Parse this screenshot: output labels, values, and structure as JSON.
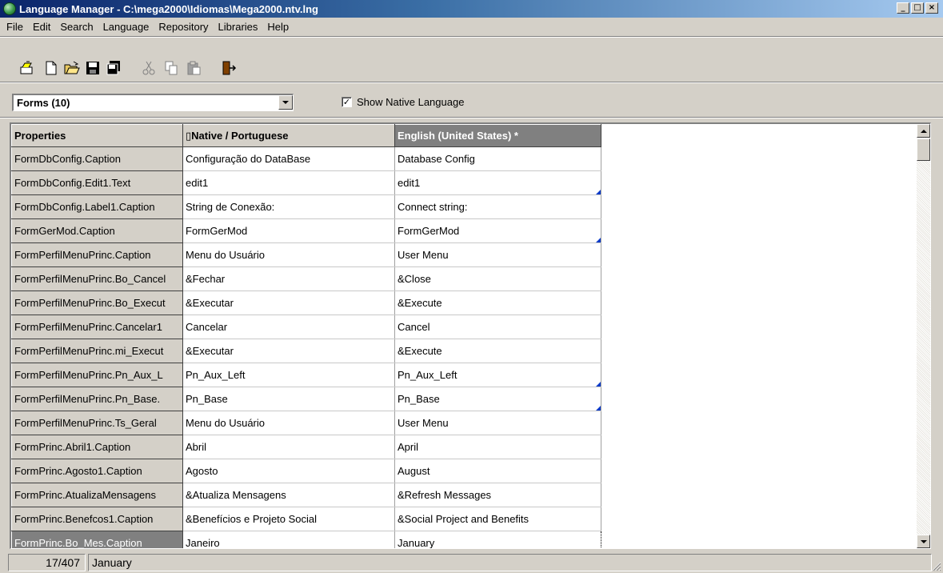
{
  "window": {
    "title": "Language Manager - C:\\mega2000\\Idiomas\\Mega2000.ntv.lng",
    "caption_buttons": [
      "minimize",
      "maximize",
      "close"
    ]
  },
  "menu": [
    "File",
    "Edit",
    "Search",
    "Language",
    "Repository",
    "Libraries",
    "Help"
  ],
  "toolbar": {
    "icons": [
      "repository-open-icon",
      "new-file-icon",
      "open-folder-icon",
      "save-icon",
      "save-all-icon",
      "cut-icon",
      "copy-icon",
      "paste-icon",
      "exit-icon"
    ]
  },
  "filter": {
    "combo_value": "Forms (10)",
    "show_native_label": "Show Native Language",
    "show_native_checked": true,
    "check_glyph": "✓"
  },
  "grid": {
    "headers": {
      "properties": "Properties",
      "native": "Native / Portuguese",
      "english": "English (United States) *"
    },
    "rows": [
      {
        "prop": "FormDbConfig.Caption",
        "native": "Configuração do DataBase",
        "en": "Database Config",
        "marked": false
      },
      {
        "prop": "FormDbConfig.Edit1.Text",
        "native": "edit1",
        "en": "edit1",
        "marked": true
      },
      {
        "prop": "FormDbConfig.Label1.Caption",
        "native": "String de Conexão:",
        "en": "Connect string:",
        "marked": false
      },
      {
        "prop": "FormGerMod.Caption",
        "native": "FormGerMod",
        "en": "FormGerMod",
        "marked": true
      },
      {
        "prop": "FormPerfilMenuPrinc.Caption",
        "native": "Menu do Usuário",
        "en": "User Menu",
        "marked": false
      },
      {
        "prop": "FormPerfilMenuPrinc.Bo_Cancel",
        "native": "&Fechar",
        "en": "&Close",
        "marked": false
      },
      {
        "prop": "FormPerfilMenuPrinc.Bo_Execut",
        "native": "&Executar",
        "en": "&Execute",
        "marked": false
      },
      {
        "prop": "FormPerfilMenuPrinc.Cancelar1",
        "native": "Cancelar",
        "en": "Cancel",
        "marked": false
      },
      {
        "prop": "FormPerfilMenuPrinc.mi_Execut",
        "native": "&Executar",
        "en": "&Execute",
        "marked": false
      },
      {
        "prop": "FormPerfilMenuPrinc.Pn_Aux_L",
        "native": "Pn_Aux_Left",
        "en": "Pn_Aux_Left",
        "marked": true
      },
      {
        "prop": "FormPerfilMenuPrinc.Pn_Base.",
        "native": "Pn_Base",
        "en": "Pn_Base",
        "marked": true
      },
      {
        "prop": "FormPerfilMenuPrinc.Ts_Geral",
        "native": "Menu do Usuário",
        "en": "User Menu",
        "marked": false
      },
      {
        "prop": "FormPrinc.Abril1.Caption",
        "native": "Abril",
        "en": "April",
        "marked": false
      },
      {
        "prop": "FormPrinc.Agosto1.Caption",
        "native": "Agosto",
        "en": "August",
        "marked": false
      },
      {
        "prop": "FormPrinc.AtualizaMensagens",
        "native": "&Atualiza Mensagens",
        "en": "&Refresh Messages",
        "marked": false
      },
      {
        "prop": "FormPrinc.Benefcos1.Caption",
        "native": "&Benefícios e Projeto Social",
        "en": "&Social Project and Benefits",
        "marked": false
      },
      {
        "prop": "FormPrinc.Bo_Mes.Caption",
        "native": "Janeiro",
        "en": "January",
        "marked": false,
        "selected": true
      }
    ]
  },
  "status": {
    "position": "17/407",
    "text": "January"
  }
}
